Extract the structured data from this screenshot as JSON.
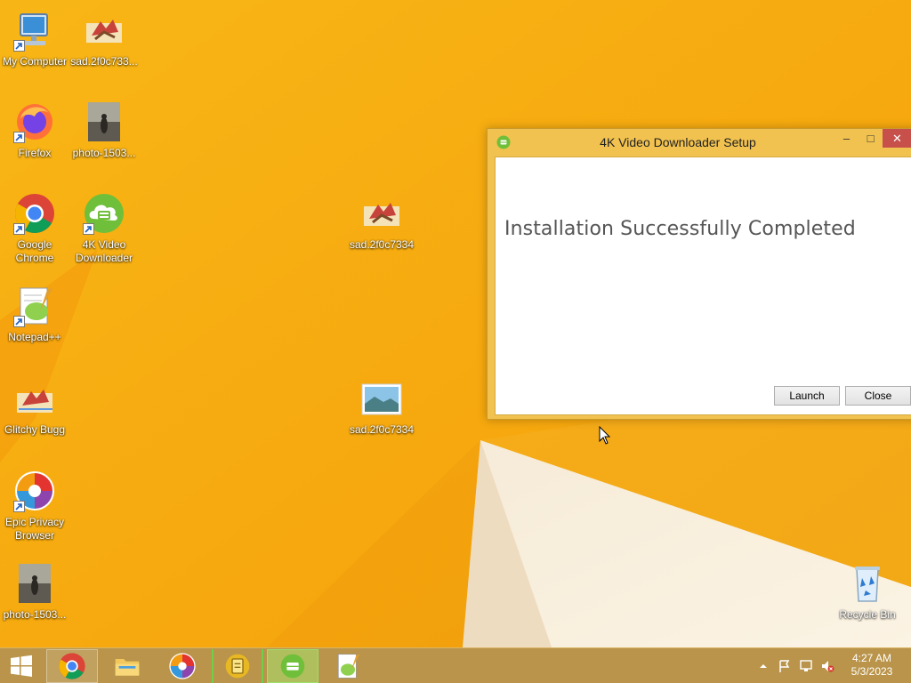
{
  "desktop": {
    "icons": [
      {
        "label": "My Computer",
        "icon": "computer-icon"
      },
      {
        "label": "sad.2f0c733...",
        "icon": "image-file-icon"
      },
      {
        "label": "Firefox",
        "icon": "firefox-icon"
      },
      {
        "label": "photo-1503...",
        "icon": "photo-file-icon"
      },
      {
        "label": "Google",
        "label2": "Chrome",
        "icon": "chrome-icon"
      },
      {
        "label": "4K Video",
        "label2": "Downloader",
        "icon": "4k-video-downloader-icon"
      },
      {
        "label": "sad.2f0c7334",
        "icon": "image-file-icon"
      },
      {
        "label": "Notepad++",
        "icon": "notepad-plus-plus-icon"
      },
      {
        "label": "Glitchy Bugg",
        "icon": "glitchy-bugg-icon"
      },
      {
        "label": "sad.2f0c7334",
        "icon": "landscape-image-icon"
      },
      {
        "label": "Epic Privacy",
        "label2": "Browser",
        "icon": "epic-browser-icon"
      },
      {
        "label": "photo-1503...",
        "icon": "photo-file-icon"
      },
      {
        "label": "Recycle Bin",
        "icon": "recycle-bin-icon"
      }
    ]
  },
  "setup_window": {
    "title": "4K Video Downloader Setup",
    "minimize_glyph": "–",
    "maximize_glyph": "□",
    "close_glyph": "✕",
    "headline": "Installation Successfully Completed",
    "launch_label": "Launch",
    "close_label": "Close"
  },
  "taskbar": {
    "items": [
      "start-icon",
      "chrome-icon",
      "file-explorer-icon",
      "epic-browser-icon",
      "notes-app-icon",
      "4k-video-downloader-icon",
      "notepad-plus-plus-icon"
    ],
    "tray": [
      "show-hidden-icons-chevron",
      "action-center-flag-icon",
      "network-icon",
      "volume-muted-icon"
    ],
    "time": "4:27 AM",
    "date": "5/3/2023"
  },
  "colors": {
    "wallpaper": "#f6ad12",
    "taskbar": "#b9944a",
    "window_frame": "#f1c24f",
    "close_button": "#c7504b",
    "downloader_green": "#6fbf3a"
  }
}
